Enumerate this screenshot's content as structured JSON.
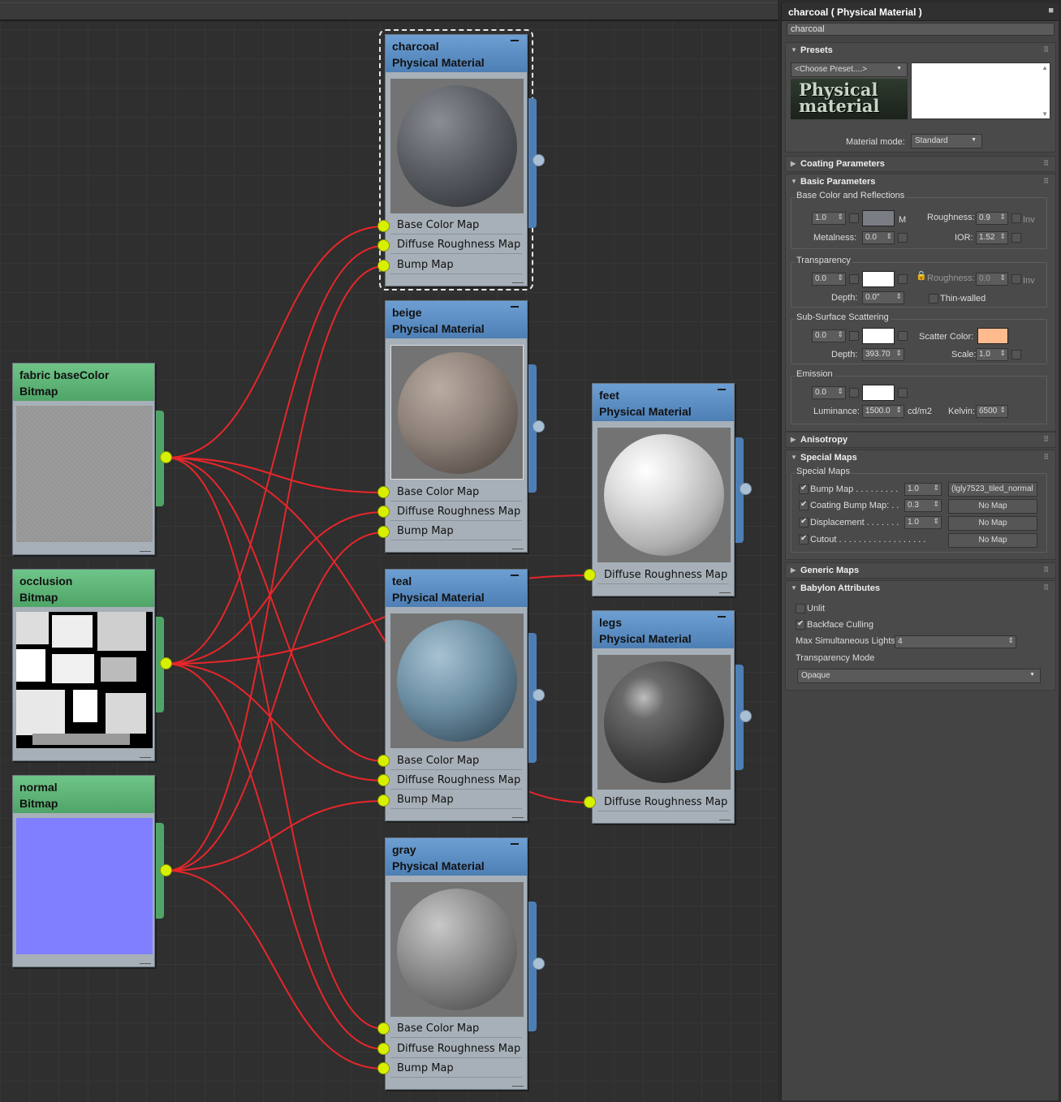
{
  "panel": {
    "title": "charcoal  ( Physical Material )",
    "material_name": "charcoal",
    "presets": {
      "header": "Presets",
      "choose_preset": "<Choose Preset....>",
      "logo_text": "Physical material",
      "material_mode_label": "Material mode:",
      "material_mode_value": "Standard"
    },
    "coating": {
      "header": "Coating Parameters"
    },
    "basic": {
      "header": "Basic Parameters",
      "base_group": "Base Color and Reflections",
      "base_weight": "1.0",
      "m_label": "M",
      "roughness_label": "Roughness:",
      "roughness_value": "0.9",
      "inv_label": "Inv",
      "metalness_label": "Metalness:",
      "metalness_value": "0.0",
      "ior_label": "IOR:",
      "ior_value": "1.52",
      "transparency_group": "Transparency",
      "transparency_value": "0.0",
      "trans_roughness_label": "Roughness:",
      "trans_roughness_value": "0.0",
      "trans_inv_label": "Inv",
      "depth_label": "Depth:",
      "depth_value": "0.0\"",
      "thin_walled_label": "Thin-walled",
      "sss_group": "Sub-Surface Scattering",
      "sss_value": "0.0",
      "scatter_color_label": "Scatter Color:",
      "sss_depth_label": "Depth:",
      "sss_depth_value": "393.70",
      "scale_label": "Scale:",
      "scale_value": "1.0",
      "emission_group": "Emission",
      "emission_value": "0.0",
      "luminance_label": "Luminance:",
      "luminance_value": "1500.0",
      "luminance_unit": "cd/m2",
      "kelvin_label": "Kelvin:",
      "kelvin_value": "6500"
    },
    "anisotropy": {
      "header": "Anisotropy"
    },
    "special_maps": {
      "header": "Special Maps",
      "group": "Special Maps",
      "rows": [
        {
          "label": "Bump Map . . . . . . . . .",
          "value": "1.0",
          "map": "(lgly7523_tiled_normal"
        },
        {
          "label": "Coating Bump Map: . .",
          "value": "0.3",
          "map": "No Map"
        },
        {
          "label": "Displacement . . . . . . .",
          "value": "1.0",
          "map": "No Map"
        },
        {
          "label": "Cutout . . . . . . . . . . . . . . . . . .",
          "value": "",
          "map": "No Map"
        }
      ]
    },
    "generic": {
      "header": "Generic Maps"
    },
    "babylon": {
      "header": "Babylon Attributes",
      "unlit": "Unlit",
      "backface": "Backface Culling",
      "max_lights_label": "Max Simultaneous Lights",
      "max_lights_value": "4",
      "transparency_mode_label": "Transparency Mode",
      "transparency_mode_value": "Opaque"
    },
    "colors": {
      "base_color": "#7a7d84",
      "white": "#ffffff",
      "scatter_color": "#ffbb8e"
    }
  },
  "nodes": {
    "charcoal": {
      "name": "charcoal",
      "type": "Physical Material",
      "slots": [
        "Base Color Map",
        "Diffuse Roughness Map",
        "Bump Map"
      ]
    },
    "beige": {
      "name": "beige",
      "type": "Physical Material",
      "slots": [
        "Base Color Map",
        "Diffuse Roughness Map",
        "Bump Map"
      ]
    },
    "teal": {
      "name": "teal",
      "type": "Physical Material",
      "slots": [
        "Base Color Map",
        "Diffuse Roughness Map",
        "Bump Map"
      ]
    },
    "gray": {
      "name": "gray",
      "type": "Physical Material",
      "slots": [
        "Base Color Map",
        "Diffuse Roughness Map",
        "Bump Map"
      ]
    },
    "feet": {
      "name": "feet",
      "type": "Physical Material",
      "slots": [
        "Diffuse Roughness Map"
      ]
    },
    "legs": {
      "name": "legs",
      "type": "Physical Material",
      "slots": [
        "Diffuse Roughness Map"
      ]
    },
    "fabric": {
      "name": "fabric baseColor",
      "type": "Bitmap"
    },
    "occlusion": {
      "name": "occlusion",
      "type": "Bitmap"
    },
    "normal": {
      "name": "normal",
      "type": "Bitmap"
    }
  },
  "node_colors": {
    "wire": "#e8262a",
    "charcoal_sphere": "#555a60",
    "beige_sphere": "#8b8078",
    "teal_sphere": "#6c8ea3",
    "gray_sphere": "#8a8a8a",
    "feet_sphere": "#d9d9d9",
    "legs_sphere": "#4a4a4a",
    "fabric_preview": "#9a9a9a",
    "normal_preview": "#7f7fff"
  }
}
